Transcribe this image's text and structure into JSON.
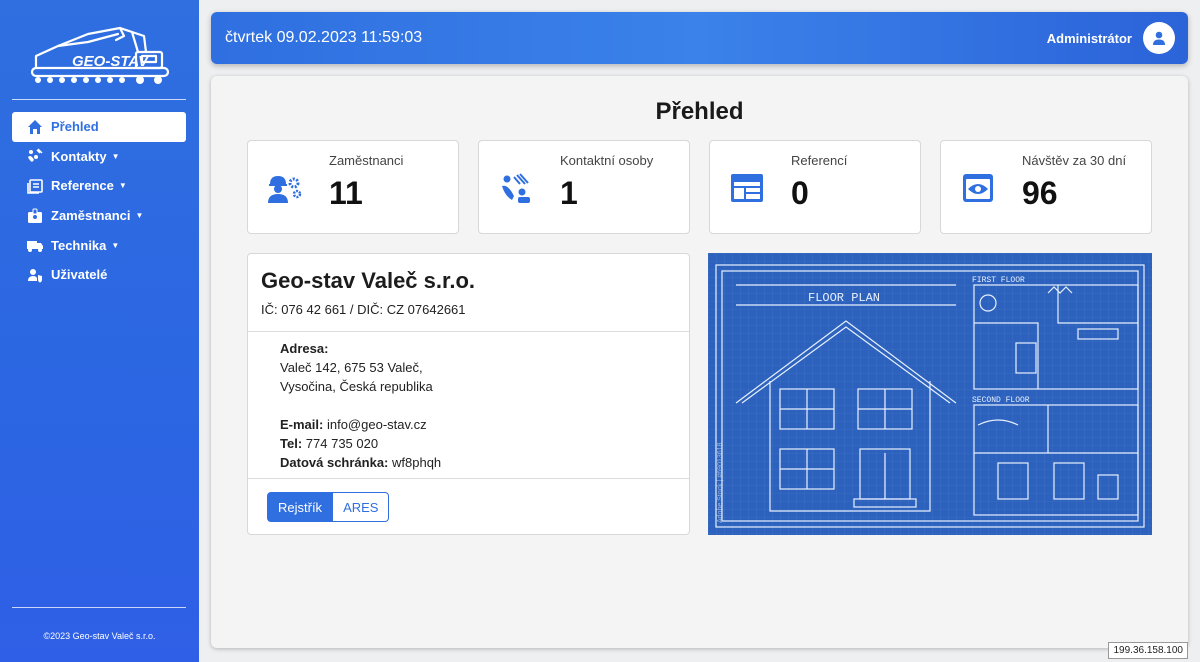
{
  "sidebar": {
    "logo_text": "GEO-STAV",
    "items": [
      {
        "label": "Přehled",
        "icon": "home-icon",
        "active": true,
        "has_caret": false
      },
      {
        "label": "Kontakty",
        "icon": "contacts-icon",
        "active": false,
        "has_caret": true
      },
      {
        "label": "Reference",
        "icon": "reference-icon",
        "active": false,
        "has_caret": true
      },
      {
        "label": "Zaměstnanci",
        "icon": "badge-icon",
        "active": false,
        "has_caret": true
      },
      {
        "label": "Technika",
        "icon": "truck-icon",
        "active": false,
        "has_caret": true
      },
      {
        "label": "Uživatelé",
        "icon": "users-shield-icon",
        "active": false,
        "has_caret": false
      }
    ],
    "copyright": "©2023 Geo-stav Valeč s.r.o."
  },
  "header": {
    "datetime": "čtvrtek 09.02.2023 11:59:03",
    "user": "Administrátor"
  },
  "main": {
    "title": "Přehled",
    "stats": [
      {
        "label": "Zaměstnanci",
        "value": "11",
        "icon": "workers-icon"
      },
      {
        "label": "Kontaktní osoby",
        "value": "1",
        "icon": "contacts-icon"
      },
      {
        "label": "Referencí",
        "value": "0",
        "icon": "table-icon"
      },
      {
        "label": "Návštěv za 30 dní",
        "value": "96",
        "icon": "eye-icon"
      }
    ],
    "company": {
      "name": "Geo-stav Valeč s.r.o.",
      "ids": "IČ: 076 42 661 / DIČ: CZ 07642661",
      "address_label": "Adresa:",
      "address_line1": "Valeč 142, 675 53 Valeč,",
      "address_line2": "Vysočina, Česká republika",
      "email_label": "E-mail:",
      "email": "info@geo-stav.cz",
      "phone_label": "Tel:",
      "phone": "774 735 020",
      "databox_label": "Datová schránka:",
      "databox": "wf8phqh",
      "btn_registry": "Rejstřík",
      "btn_ares": "ARES"
    },
    "blueprint": {
      "title": "FLOOR PLAN",
      "first_floor": "FIRST FLOOR",
      "second_floor": "SECOND FLOOR",
      "watermark": "Adobe Stock | #69013618"
    }
  },
  "footer": {
    "ip": "199.36.158.100"
  },
  "colors": {
    "accent": "#2f6fe0",
    "blueprint": "#2c62bd"
  }
}
